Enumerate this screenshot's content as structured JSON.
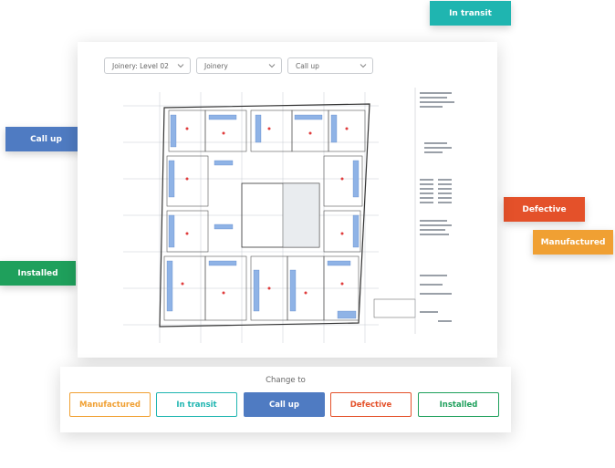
{
  "floating_tags": {
    "in_transit": "In transit",
    "call_up": "Call up",
    "defective": "Defective",
    "manufactured": "Manufactured",
    "installed": "Installed"
  },
  "filters": {
    "level": "Joinery: Level 02",
    "trade": "Joinery",
    "status": "Call up"
  },
  "change_panel": {
    "title": "Change to",
    "options": [
      "Manufactured",
      "In transit",
      "Call up",
      "Defective",
      "Installed"
    ],
    "selected": "Call up"
  },
  "colors": {
    "manufactured": "#f0a033",
    "in_transit": "#1fb5b0",
    "call_up": "#4f7bc2",
    "defective": "#e4512a",
    "installed": "#1fa05c"
  }
}
